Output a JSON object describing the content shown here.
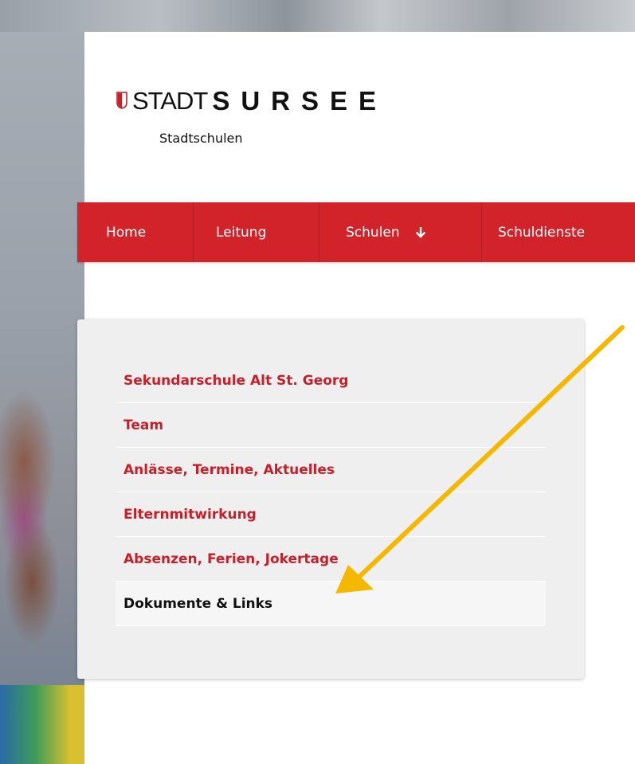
{
  "header": {
    "logo_stadt": "STADT",
    "logo_sursee": "SURSEE",
    "logo_sub": "Stadtschulen"
  },
  "nav": {
    "items": [
      {
        "label": "Home"
      },
      {
        "label": "Leitung"
      },
      {
        "label": "Schulen"
      },
      {
        "label": "Schuldienste"
      }
    ]
  },
  "side_menu": {
    "items": [
      {
        "label": "Sekundarschule Alt St. Georg"
      },
      {
        "label": "Team"
      },
      {
        "label": "Anlässe, Termine, Aktuelles"
      },
      {
        "label": "Elternmitwirkung"
      },
      {
        "label": "Absenzen, Ferien, Jokertage"
      },
      {
        "label": "Dokumente & Links"
      }
    ],
    "active_index": 5
  },
  "colors": {
    "brand_red": "#d3232a",
    "link_red": "#c8202a",
    "annotation_arrow": "#f5b800"
  },
  "icons": {
    "logo": "shield-icon",
    "dropdown": "arrow-down-icon"
  }
}
